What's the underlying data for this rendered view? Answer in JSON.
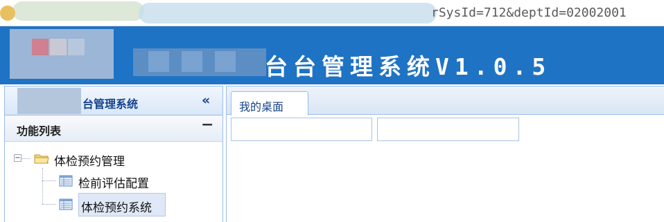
{
  "browser": {
    "url_visible": "rSysId=712&deptId=02002001"
  },
  "header": {
    "title": "台台管理系统V1.0.5",
    "background_color": "#1f73c4"
  },
  "left_panel": {
    "header_title": "台管理系统",
    "collapse_icon": "double-chevron-left-icon",
    "section_title": "功能列表",
    "section_toggle_icon": "minus-icon",
    "tree": {
      "root": {
        "label": "体检预约管理",
        "icon": "folder-icon",
        "expanded": true
      },
      "children": [
        {
          "label": "检前评估配置",
          "icon": "page-icon",
          "selected": false
        },
        {
          "label": "体检预约系统",
          "icon": "page-icon",
          "selected": true
        }
      ]
    }
  },
  "main": {
    "tabs": [
      {
        "label": "我的桌面",
        "active": true
      }
    ]
  }
}
